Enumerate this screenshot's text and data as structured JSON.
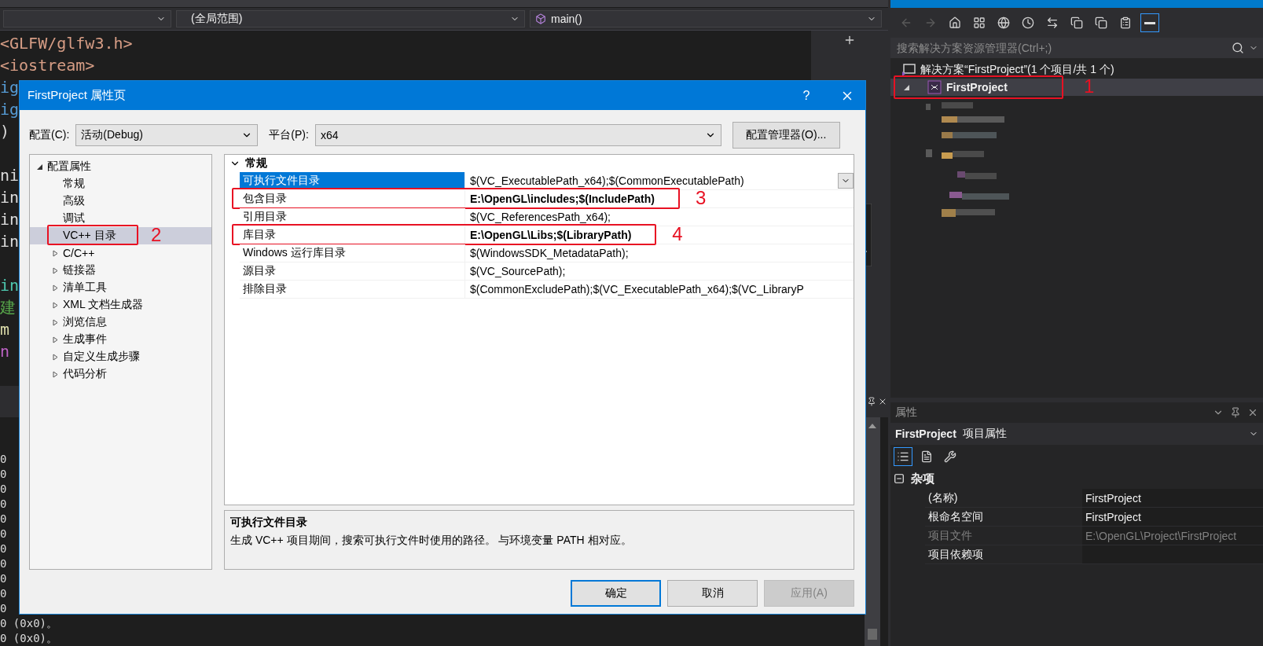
{
  "editor": {
    "nav_bar": {
      "scope": "(全局范围)",
      "member": "main()"
    },
    "code_lines": [
      {
        "text": "<GLFW/glfw3.h>",
        "kind": "string"
      },
      {
        "text": "<iostream>",
        "kind": "string"
      },
      {
        "text": "ig",
        "kind": "keyword"
      },
      {
        "text": "ig",
        "kind": "keyword"
      },
      {
        "text": ")",
        "kind": "plain"
      },
      {
        "kind": "blank"
      },
      {
        "text": "ni",
        "kind": "plain"
      },
      {
        "text": "in",
        "kind": "plain"
      },
      {
        "text": "in",
        "kind": "plain"
      },
      {
        "text": "in",
        "kind": "plain"
      },
      {
        "kind": "blank"
      },
      {
        "text": "in",
        "kind": "type"
      },
      {
        "text": "建",
        "kind": "comment"
      },
      {
        "text": "m",
        "kind": "function"
      },
      {
        "text": "n",
        "kind": "macro"
      }
    ]
  },
  "output": {
    "lines": [
      "0",
      "0",
      "0",
      "0",
      "0",
      "0",
      "0",
      "0",
      "0",
      "0",
      "0",
      "0 (0x0)。",
      "0 (0x0)。"
    ]
  },
  "solution_explorer": {
    "toolbar": [
      {
        "kind": "back",
        "disabled": true,
        "selected": false
      },
      {
        "kind": "forward",
        "disabled": true,
        "selected": false
      },
      {
        "kind": "home",
        "disabled": false,
        "selected": false
      },
      {
        "kind": "views",
        "disabled": false,
        "selected": false
      },
      {
        "kind": "globe",
        "disabled": false,
        "selected": false
      },
      {
        "kind": "history",
        "disabled": false,
        "selected": false
      },
      {
        "kind": "sync",
        "disabled": false,
        "selected": false
      },
      {
        "kind": "collapse",
        "disabled": false,
        "selected": false
      },
      {
        "kind": "copy",
        "disabled": false,
        "selected": false
      },
      {
        "kind": "properties",
        "disabled": false,
        "selected": false
      },
      {
        "kind": "preview",
        "disabled": false,
        "selected": true
      }
    ],
    "search": {
      "placeholder": "搜索解决方案资源管理器(Ctrl+;)"
    },
    "tree": [
      {
        "label": "解决方案“FirstProject”(1 个项目/共 1 个)",
        "kind": "solution",
        "selected": false,
        "children": [
          {
            "label": "FirstProject",
            "kind": "project",
            "selected": true,
            "expanded": true,
            "callout": "1"
          }
        ]
      }
    ]
  },
  "properties": {
    "title": "属性",
    "object_name": "FirstProject",
    "object_type": "项目属性",
    "toolbar": [
      {
        "kind": "categorized",
        "selected": true
      },
      {
        "kind": "pages",
        "selected": false
      },
      {
        "kind": "settings",
        "selected": false
      }
    ],
    "category": "杂项",
    "expanded": true,
    "rows": [
      {
        "name": "(名称)",
        "value": "FirstProject",
        "disabled": false
      },
      {
        "name": "根命名空间",
        "value": "FirstProject",
        "disabled": false
      },
      {
        "name": "项目文件",
        "value": "E:\\OpenGL\\Project\\FirstProject",
        "disabled": true
      },
      {
        "name": "项目依赖项",
        "disabled": false
      }
    ]
  },
  "dialog": {
    "title": "FirstProject 属性页",
    "help": "?",
    "config_label": "配置(C):",
    "config_value": "活动(Debug)",
    "platform_label": "平台(P):",
    "platform_value": "x64",
    "manager_button": "配置管理器(O)...",
    "tree": [
      {
        "label": "配置属性",
        "expanded": true,
        "selected": false,
        "children": [
          {
            "label": "常规",
            "selected": false
          },
          {
            "label": "高级",
            "selected": false
          },
          {
            "label": "调试",
            "selected": false
          },
          {
            "label": "VC++ 目录",
            "selected": true,
            "callout": "2"
          },
          {
            "label": "C/C++",
            "selected": false,
            "expanded": false
          },
          {
            "label": "链接器",
            "selected": false,
            "expanded": false
          },
          {
            "label": "清单工具",
            "selected": false,
            "expanded": false
          },
          {
            "label": "XML 文档生成器",
            "selected": false,
            "expanded": false
          },
          {
            "label": "浏览信息",
            "selected": false,
            "expanded": false
          },
          {
            "label": "生成事件",
            "selected": false,
            "expanded": false
          },
          {
            "label": "自定义生成步骤",
            "selected": false,
            "expanded": false
          },
          {
            "label": "代码分析",
            "selected": false,
            "expanded": false
          }
        ]
      }
    ],
    "grid": {
      "category": "常规",
      "expanded": true,
      "rows": [
        {
          "name": "可执行文件目录",
          "value": "$(VC_ExecutablePath_x64);$(CommonExecutablePath)",
          "selected": true,
          "overridden": false
        },
        {
          "name": "包含目录",
          "value": "E:\\OpenGL\\includes;$(IncludePath)",
          "selected": false,
          "overridden": true,
          "callout": "3"
        },
        {
          "name": "引用目录",
          "value": "$(VC_ReferencesPath_x64);",
          "selected": false,
          "overridden": false
        },
        {
          "name": "库目录",
          "value": "E:\\OpenGL\\Libs;$(LibraryPath)",
          "selected": false,
          "overridden": true,
          "callout": "4"
        },
        {
          "name": "Windows 运行库目录",
          "value": "$(WindowsSDK_MetadataPath);",
          "selected": false,
          "overridden": false
        },
        {
          "name": "源目录",
          "value": "$(VC_SourcePath);",
          "selected": false,
          "overridden": false
        },
        {
          "name": "排除目录",
          "value": "$(CommonExcludePath);$(VC_ExecutablePath_x64);$(VC_LibraryP",
          "selected": false,
          "overridden": false
        }
      ]
    },
    "description": {
      "title": "可执行文件目录",
      "text": "生成 VC++ 项目期间，搜索可执行文件时使用的路径。 与环境变量 PATH 相对应。"
    },
    "buttons": [
      {
        "label": "确定",
        "kind": "default",
        "disabled": false
      },
      {
        "label": "取消",
        "kind": "normal",
        "disabled": false
      },
      {
        "label": "应用(A)",
        "kind": "normal",
        "disabled": true
      }
    ]
  }
}
